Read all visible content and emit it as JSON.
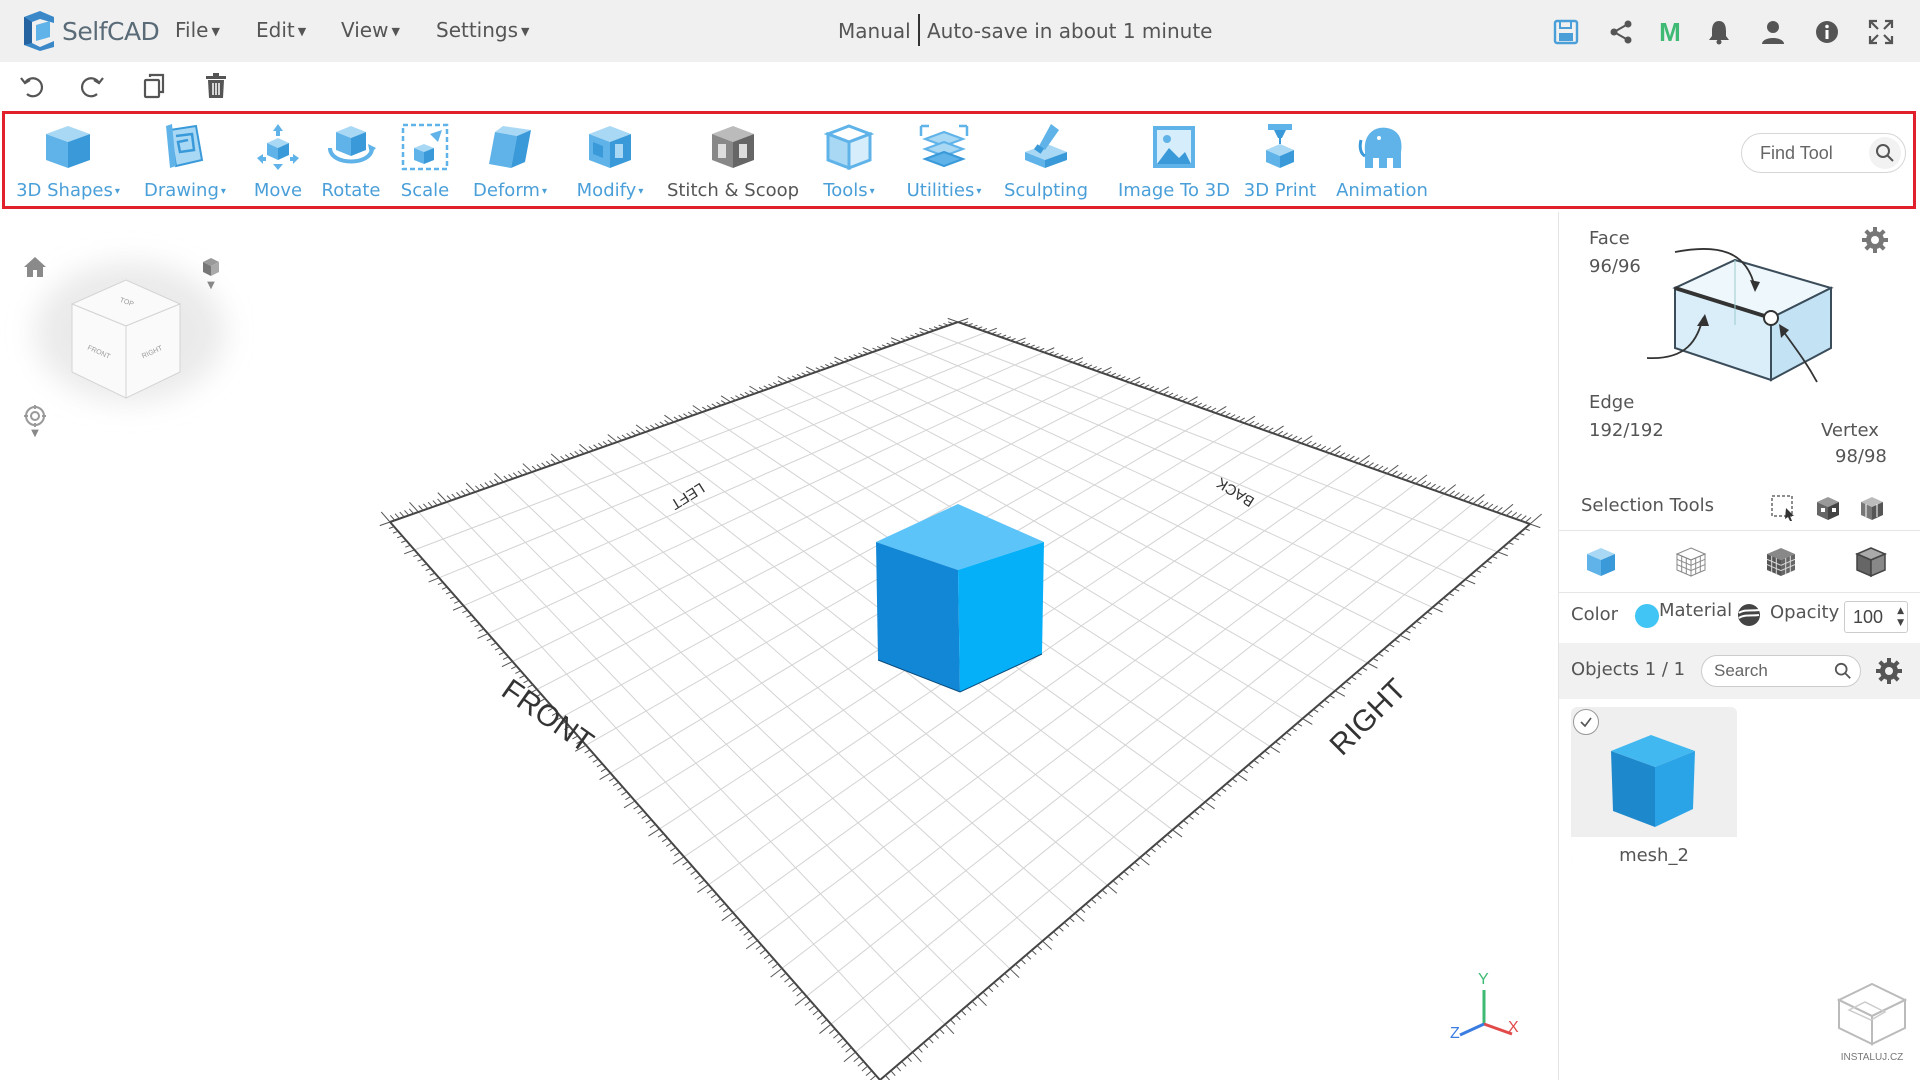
{
  "app": {
    "name": "SelfCAD",
    "accent_color": "#4a9fd9",
    "highlight_color": "#e0202a"
  },
  "menu": [
    {
      "label": "File"
    },
    {
      "label": "Edit"
    },
    {
      "label": "View"
    },
    {
      "label": "Settings"
    }
  ],
  "status": {
    "mode": "Manual",
    "autosave": "Auto-save in about 1 minute"
  },
  "top_icons": [
    "save-icon",
    "share-icon",
    "m-logo-icon",
    "bell-icon",
    "user-icon",
    "info-icon",
    "fullscreen-icon"
  ],
  "top_icons_labels": {
    "m_logo": "M"
  },
  "quick_actions": [
    "undo-icon",
    "redo-icon",
    "copy-icon",
    "delete-icon"
  ],
  "toolbar": {
    "tools": [
      {
        "label": "3D Shapes",
        "dropdown": "▾"
      },
      {
        "label": "Drawing",
        "dropdown": "▾"
      },
      {
        "label": "Move"
      },
      {
        "label": "Rotate"
      },
      {
        "label": "Scale"
      },
      {
        "label": "Deform",
        "dropdown": "▾"
      },
      {
        "label": "Modify",
        "dropdown": "▾"
      },
      {
        "label": "Stitch & Scoop"
      },
      {
        "label": "Tools",
        "dropdown": "▾"
      },
      {
        "label": "Utilities",
        "dropdown": "▾"
      },
      {
        "label": "Sculpting"
      },
      {
        "label": "Image To 3D"
      },
      {
        "label": "3D Print"
      },
      {
        "label": "Animation"
      }
    ],
    "find_tool_placeholder": "Find Tool"
  },
  "viewport": {
    "grid_labels": {
      "left": "LEFT",
      "back": "BACK",
      "front": "FRONT",
      "right": "RIGHT"
    },
    "view_cube": {
      "top": "TOP",
      "front": "FRONT",
      "right": "RIGHT"
    },
    "axes": {
      "x": "X",
      "y": "Y",
      "z": "Z"
    },
    "cube_color": "#1aa9f0",
    "watermark": "INSTALUJ.CZ"
  },
  "selection_info": {
    "face_label": "Face",
    "face_count": "96/96",
    "edge_label": "Edge",
    "edge_count": "192/192",
    "vertex_label": "Vertex",
    "vertex_count": "98/98",
    "selection_tools_label": "Selection Tools"
  },
  "properties": {
    "color_label": "Color",
    "color_value": "#40c5f4",
    "material_label": "Material",
    "opacity_label": "Opacity",
    "opacity_value": "100"
  },
  "objects": {
    "header": "Objects 1 / 1",
    "search_placeholder": "Search",
    "items": [
      {
        "name": "mesh_2",
        "selected": true
      }
    ]
  }
}
